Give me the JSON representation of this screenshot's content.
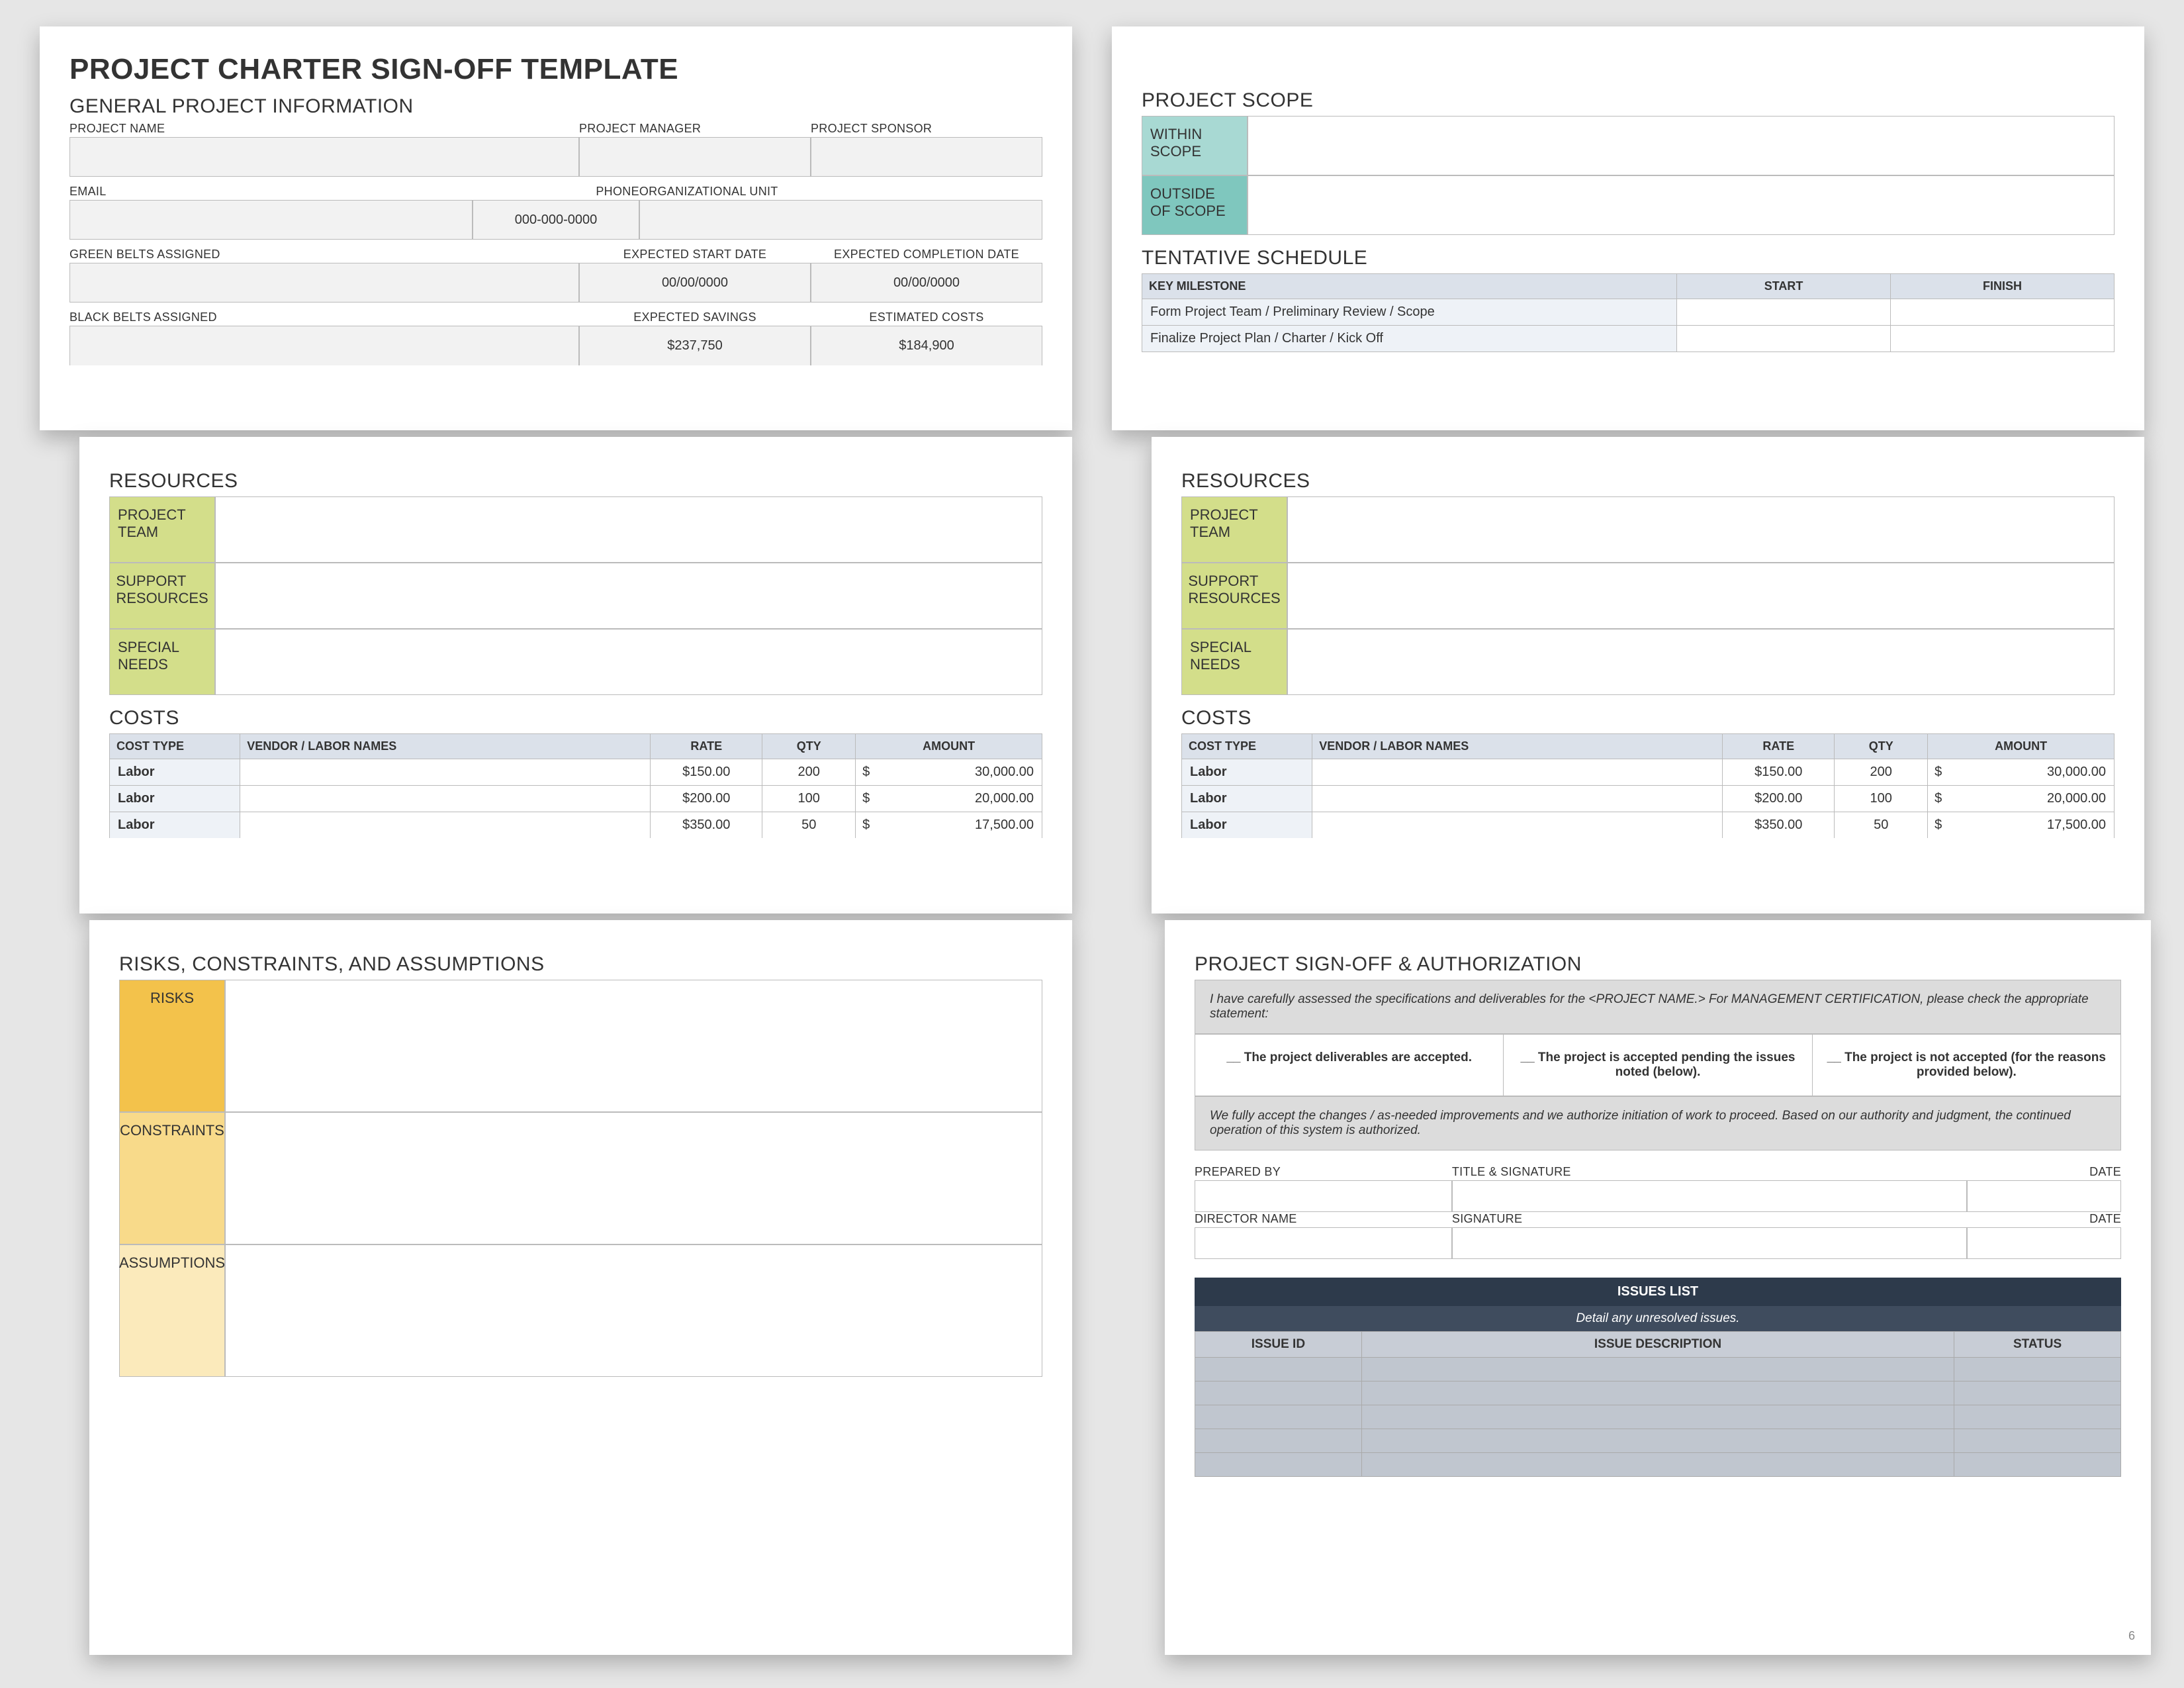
{
  "title": "PROJECT CHARTER SIGN-OFF TEMPLATE",
  "sections": {
    "general": "GENERAL PROJECT INFORMATION",
    "scope": "PROJECT SCOPE",
    "schedule": "TENTATIVE SCHEDULE",
    "resources": "RESOURCES",
    "costs": "COSTS",
    "risks": "RISKS, CONSTRAINTS, AND ASSUMPTIONS",
    "signoff": "PROJECT SIGN-OFF & AUTHORIZATION"
  },
  "labels": {
    "project_name": "PROJECT NAME",
    "project_manager": "PROJECT MANAGER",
    "project_sponsor": "PROJECT SPONSOR",
    "email": "EMAIL",
    "phone": "PHONE",
    "org_unit": "ORGANIZATIONAL UNIT",
    "green_belts": "GREEN BELTS ASSIGNED",
    "exp_start": "EXPECTED START DATE",
    "exp_completion": "EXPECTED COMPLETION DATE",
    "black_belts": "BLACK BELTS ASSIGNED",
    "exp_savings": "EXPECTED SAVINGS",
    "est_costs": "ESTIMATED COSTS",
    "within_scope": "WITHIN SCOPE",
    "outside_scope": "OUTSIDE OF SCOPE",
    "project_team": "PROJECT TEAM",
    "support_resources": "SUPPORT RESOURCES",
    "special_needs": "SPECIAL NEEDS",
    "risks": "RISKS",
    "constraints": "CONSTRAINTS",
    "assumptions": "ASSUMPTIONS",
    "prepared_by": "PREPARED BY",
    "title_sig": "TITLE & SIGNATURE",
    "date": "DATE",
    "director": "DIRECTOR NAME",
    "signature": "SIGNATURE",
    "issues_list": "ISSUES LIST",
    "issues_sub": "Detail any unresolved issues.",
    "issue_id": "ISSUE ID",
    "issue_desc": "ISSUE DESCRIPTION",
    "status": "STATUS"
  },
  "values": {
    "phone": "000-000-0000",
    "date_placeholder": "00/00/0000",
    "savings": "$237,750",
    "costs": "$184,900"
  },
  "schedule": {
    "headers": [
      "KEY MILESTONE",
      "START",
      "FINISH"
    ],
    "rows": [
      "Form Project Team / Preliminary Review / Scope",
      "Finalize Project Plan / Charter / Kick Off"
    ]
  },
  "costs_table": {
    "headers": [
      "COST TYPE",
      "VENDOR / LABOR NAMES",
      "RATE",
      "QTY",
      "AMOUNT"
    ],
    "rows": [
      {
        "type": "Labor",
        "vendor": "",
        "rate": "$150.00",
        "qty": "200",
        "amt_cur": "$",
        "amt": "30,000.00"
      },
      {
        "type": "Labor",
        "vendor": "",
        "rate": "$200.00",
        "qty": "100",
        "amt_cur": "$",
        "amt": "20,000.00"
      },
      {
        "type": "Labor",
        "vendor": "",
        "rate": "$350.00",
        "qty": "50",
        "amt_cur": "$",
        "amt": "17,500.00"
      }
    ]
  },
  "signoff": {
    "intro": "I have carefully assessed the specifications and deliverables for the <PROJECT NAME.> For MANAGEMENT CERTIFICATION, please check the appropriate statement:",
    "opt1": "__ The project deliverables are accepted.",
    "opt2": "__ The project is accepted pending the issues noted (below).",
    "opt3": "__ The project is not accepted (for the reasons provided below).",
    "accept": "We fully accept the changes / as-needed improvements and we authorize initiation of work to proceed. Based on our authority and judgment, the continued operation of this system is authorized."
  },
  "page_number": "6"
}
